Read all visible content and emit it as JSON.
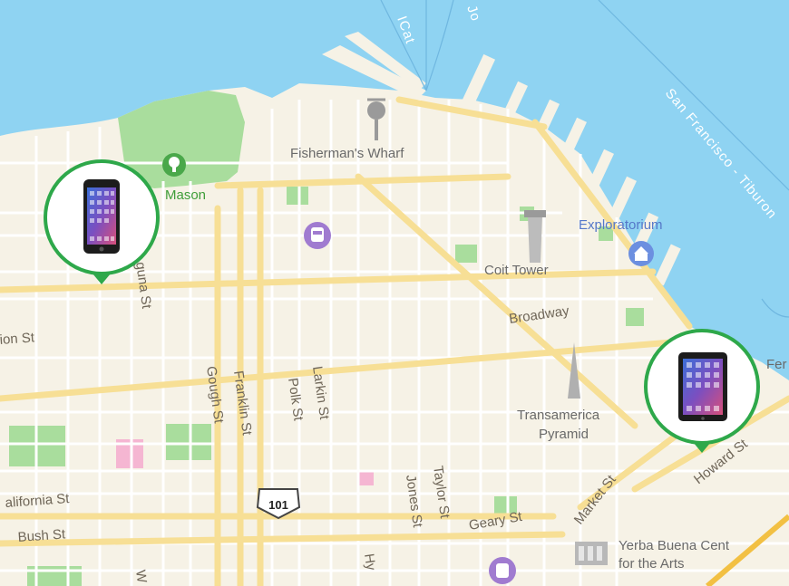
{
  "map": {
    "colors": {
      "water": "#8fd3f2",
      "land": "#f6f2e6",
      "park": "#a9dd9d",
      "minor_road": "#ffffff",
      "major_road": "#f7df95",
      "highway": "#f2c043",
      "pin_ring": "#2ea84a",
      "poi_purple": "#a07bd0",
      "poi_blue": "#6c8fe0"
    },
    "labels": {
      "fishermans_wharf": "Fisherman's Wharf",
      "fort_mason": "Mason",
      "exploratorium": "Exploratorium",
      "coit_tower": "Coit Tower",
      "broadway": "Broadway",
      "transamerica_line1": "Transamerica",
      "transamerica_line2": "Pyramid",
      "yerba_line1": "Yerba Buena Cent",
      "yerba_line2": "for the Arts",
      "ferry": "Fer",
      "sf_tiburon": "San Francisco - Tiburon",
      "water_fragment": "ICat",
      "water_fragment2": "Jo",
      "union_st": "ion St",
      "california_st": "alifornia St",
      "bush_st": "Bush St",
      "laguna_st": "guna St",
      "gough_st": "Gough St",
      "franklin_st": "Franklin St",
      "polk_st": "Polk St",
      "larkin_st": "Larkin St",
      "jones_st": "Jones St",
      "taylor_st": "Taylor St",
      "hyde_st": "Hy",
      "geary_st": "Geary St",
      "market_st": "Market St",
      "howard_st": "Howard St",
      "w_fragment": "W"
    },
    "shield": "101",
    "devices": [
      {
        "name": "iPhone",
        "icon": "iphone-icon"
      },
      {
        "name": "iPad",
        "icon": "ipad-icon"
      }
    ]
  }
}
